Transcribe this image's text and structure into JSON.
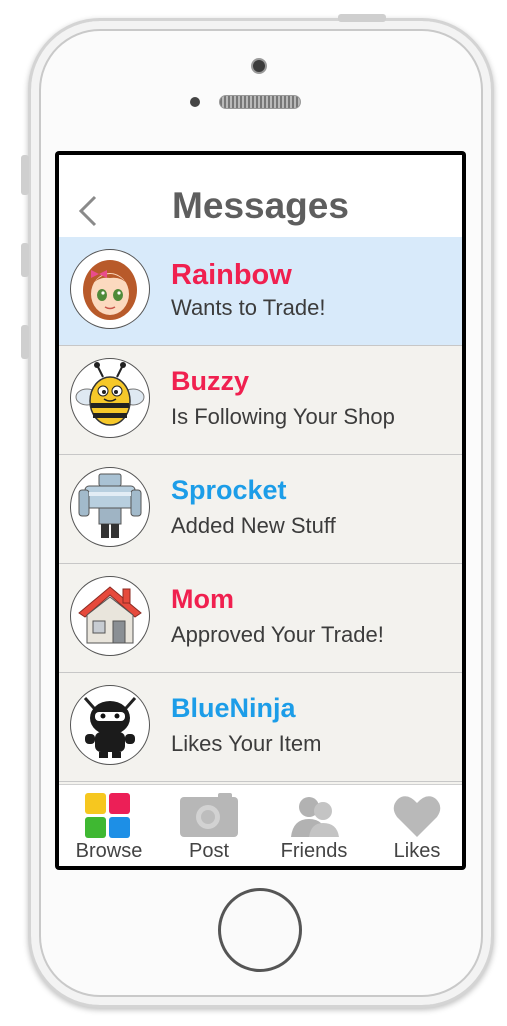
{
  "header": {
    "title": "Messages",
    "back_icon": "chevron-left-icon"
  },
  "messages": [
    {
      "name": "Rainbow",
      "text": "Wants to Trade!",
      "name_color": "#f0204f",
      "selected": true,
      "avatar": "girl-avatar-icon"
    },
    {
      "name": "Buzzy",
      "text": "Is Following Your Shop",
      "name_color": "#f0204f",
      "selected": false,
      "avatar": "bee-avatar-icon"
    },
    {
      "name": "Sprocket",
      "text": "Added New Stuff",
      "name_color": "#1c9de8",
      "selected": false,
      "avatar": "robot-avatar-icon"
    },
    {
      "name": "Mom",
      "text": "Approved Your Trade!",
      "name_color": "#f0204f",
      "selected": false,
      "avatar": "house-avatar-icon"
    },
    {
      "name": "BlueNinja",
      "text": "Likes Your Item",
      "name_color": "#1c9de8",
      "selected": false,
      "avatar": "ninja-avatar-icon"
    }
  ],
  "tabs": [
    {
      "label": "Browse",
      "icon": "color-grid-icon"
    },
    {
      "label": "Post",
      "icon": "camera-icon"
    },
    {
      "label": "Friends",
      "icon": "friends-icon"
    },
    {
      "label": "Likes",
      "icon": "heart-icon"
    }
  ],
  "colors": {
    "accent_pink": "#f0204f",
    "accent_blue": "#1c9de8",
    "selected_row": "#d8eafa"
  }
}
